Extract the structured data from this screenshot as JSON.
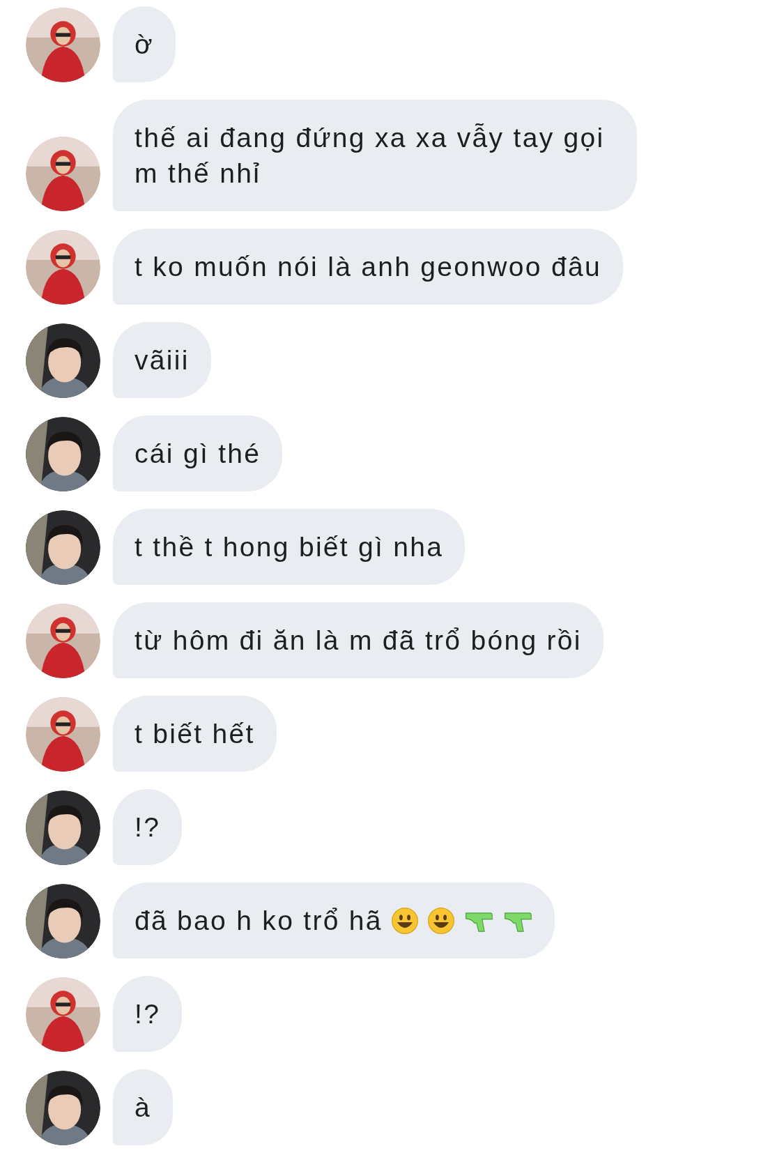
{
  "messages": [
    {
      "kind": "hoodie",
      "text": "ờ"
    },
    {
      "kind": "hoodie",
      "text": "thế ai đang đứng xa xa vẫy tay gọi m thế nhỉ"
    },
    {
      "kind": "hoodie",
      "text": "t ko muốn nói là anh geonwoo đâu"
    },
    {
      "kind": "dark",
      "text": "vãiii"
    },
    {
      "kind": "dark",
      "text": "cái gì thé"
    },
    {
      "kind": "dark",
      "text": "t thề t hong biết gì nha"
    },
    {
      "kind": "hoodie",
      "text": "từ hôm đi ăn là m đã trổ bóng rồi"
    },
    {
      "kind": "hoodie",
      "text": "t biết hết"
    },
    {
      "kind": "dark",
      "text": "!?"
    },
    {
      "kind": "dark",
      "text": "đã bao h ko trổ hã",
      "emoji": [
        {
          "kind": "smiley"
        },
        {
          "kind": "smiley"
        },
        {
          "kind": "pistol"
        },
        {
          "kind": "pistol"
        }
      ]
    },
    {
      "kind": "hoodie",
      "text": "!?"
    },
    {
      "kind": "dark",
      "text": "à"
    }
  ]
}
